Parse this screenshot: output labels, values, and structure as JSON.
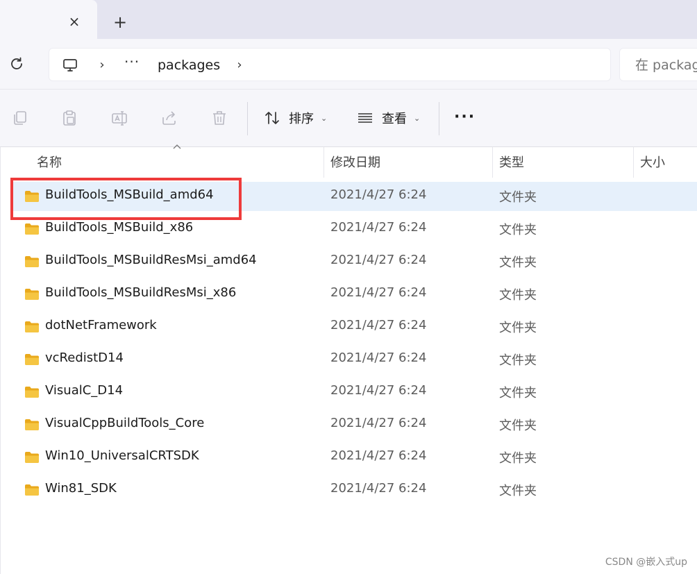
{
  "window": {
    "tab": {
      "close_glyph": "×"
    },
    "new_tab_glyph": "+"
  },
  "address": {
    "breadcrumb_overflow": "···",
    "current_folder": "packages",
    "search_placeholder": "在 packages 中搜索"
  },
  "commands": {
    "sort_label": "排序",
    "view_label": "查看",
    "more_glyph": "···"
  },
  "columns": {
    "name": "名称",
    "date": "修改日期",
    "type": "类型",
    "size": "大小"
  },
  "files": [
    {
      "name": "BuildTools_MSBuild_amd64",
      "date": "2021/4/27 6:24",
      "type": "文件夹",
      "selected": true
    },
    {
      "name": "BuildTools_MSBuild_x86",
      "date": "2021/4/27 6:24",
      "type": "文件夹"
    },
    {
      "name": "BuildTools_MSBuildResMsi_amd64",
      "date": "2021/4/27 6:24",
      "type": "文件夹"
    },
    {
      "name": "BuildTools_MSBuildResMsi_x86",
      "date": "2021/4/27 6:24",
      "type": "文件夹"
    },
    {
      "name": "dotNetFramework",
      "date": "2021/4/27 6:24",
      "type": "文件夹"
    },
    {
      "name": "vcRedistD14",
      "date": "2021/4/27 6:24",
      "type": "文件夹"
    },
    {
      "name": "VisualC_D14",
      "date": "2021/4/27 6:24",
      "type": "文件夹"
    },
    {
      "name": "VisualCppBuildTools_Core",
      "date": "2021/4/27 6:24",
      "type": "文件夹"
    },
    {
      "name": "Win10_UniversalCRTSDK",
      "date": "2021/4/27 6:24",
      "type": "文件夹"
    },
    {
      "name": "Win81_SDK",
      "date": "2021/4/27 6:24",
      "type": "文件夹"
    }
  ],
  "colors": {
    "selection": "#e6f0fb",
    "highlight_box": "#ee3b3b",
    "folder": "#f5c542"
  },
  "watermark": "CSDN @嵌入式up"
}
